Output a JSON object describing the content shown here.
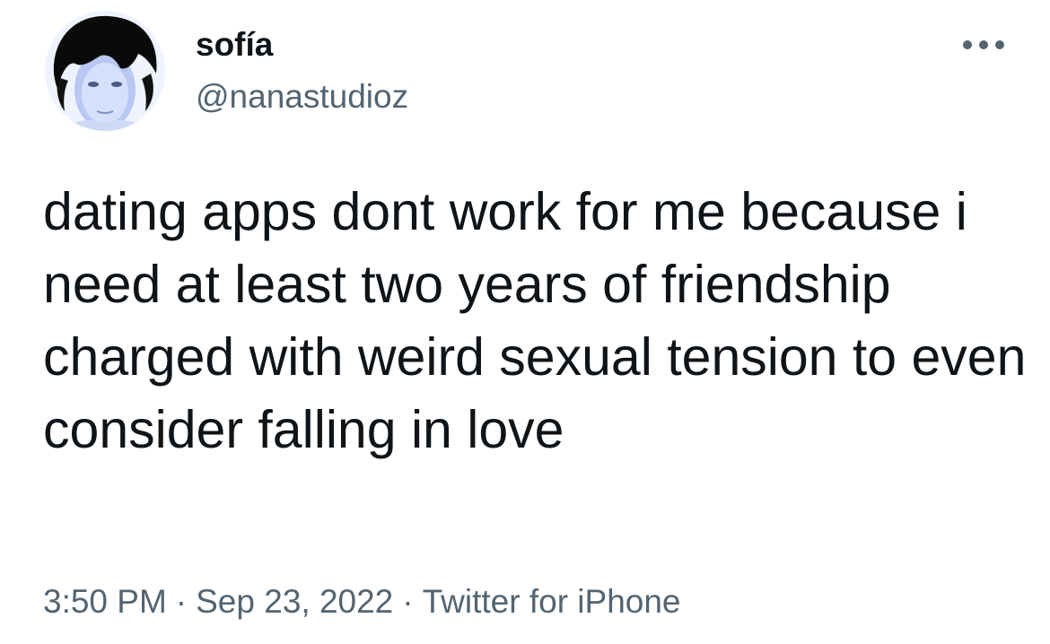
{
  "author": {
    "display_name": "sofía",
    "handle": "@nanastudioz",
    "avatar_icon": "profile-photo"
  },
  "tweet": {
    "text": "dating apps dont work for me because i need at least two years of friendship charged with weird sexual tension to even consider falling in love",
    "time": "3:50 PM",
    "date": "Sep 23, 2022",
    "source": "Twitter for iPhone",
    "separator": "·"
  },
  "menu": {
    "icon": "more-horizontal-icon"
  },
  "colors": {
    "text_primary": "#0f1419",
    "text_secondary": "#536471",
    "background": "#ffffff"
  }
}
